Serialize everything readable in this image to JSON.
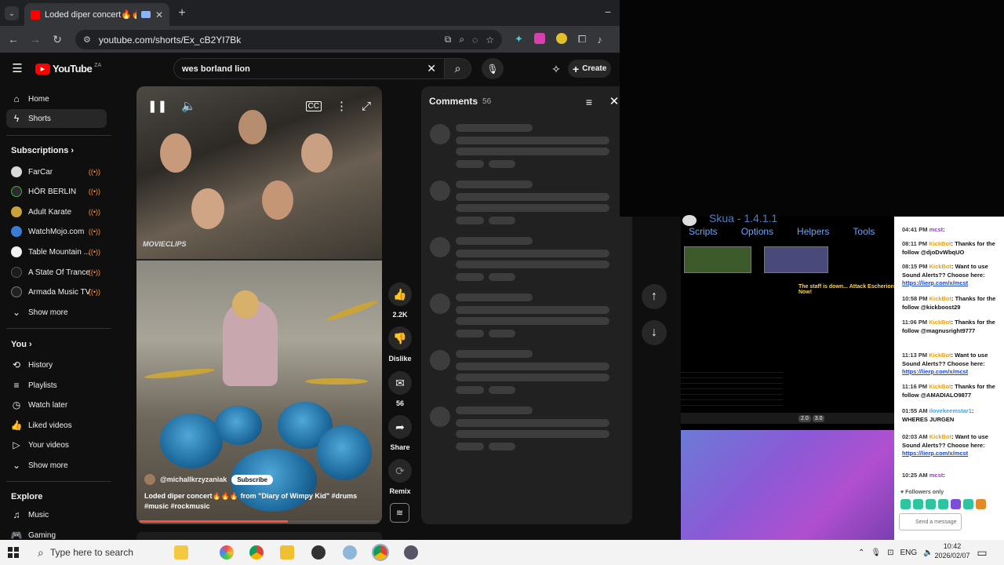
{
  "browser": {
    "tab_title": "Loded diper concert🔥🔥🔥",
    "url": "youtube.com/shorts/Ex_cB2YI7Bk",
    "new_tab": "+",
    "minimize": "−"
  },
  "youtube": {
    "logo": "YouTube",
    "logo_region": "ZA",
    "search_value": "wes borland lion",
    "create_label": "Create"
  },
  "sidebar": {
    "main": [
      {
        "label": "Home",
        "icon": "home-icon"
      },
      {
        "label": "Shorts",
        "icon": "shorts-icon"
      }
    ],
    "subscriptions_header": "Subscriptions",
    "subscriptions": [
      {
        "label": "FarCar",
        "color": "#d9d9d9"
      },
      {
        "label": "HÖR BERLIN",
        "color": "#2b2b2b"
      },
      {
        "label": "Adult Karate",
        "color": "#c9a13b"
      },
      {
        "label": "WatchMojo.com",
        "color": "#3a7bd5"
      },
      {
        "label": "Table Mountain ...",
        "color": "#f2f2f2"
      },
      {
        "label": "A State Of Trance",
        "color": "#1c1c1c"
      },
      {
        "label": "Armada Music TV",
        "color": "#222222"
      }
    ],
    "show_more_1": "Show more",
    "you_header": "You",
    "you_items": [
      {
        "label": "History",
        "icon": "history-icon"
      },
      {
        "label": "Playlists",
        "icon": "playlists-icon"
      },
      {
        "label": "Watch later",
        "icon": "watch-later-icon"
      },
      {
        "label": "Liked videos",
        "icon": "liked-icon"
      },
      {
        "label": "Your videos",
        "icon": "your-videos-icon"
      }
    ],
    "show_more_2": "Show more",
    "explore_header": "Explore",
    "explore_items": [
      {
        "label": "Music",
        "icon": "music-icon"
      },
      {
        "label": "Gaming",
        "icon": "gaming-icon"
      }
    ]
  },
  "short": {
    "channel": "@michallkrzyzaniak",
    "subscribe": "Subscribe",
    "title": "Loded diper concert🔥🔥🔥 from \"Diary of Wimpy Kid\" #drums #music #rockmusic",
    "watermark": "MOVIECLIPS",
    "progress": 0.62
  },
  "actions": {
    "likes": "2.2K",
    "dislike": "Dislike",
    "comments": "56",
    "share": "Share",
    "remix": "Remix"
  },
  "comments_panel": {
    "title": "Comments",
    "count": "56"
  },
  "stream": {
    "game_title": "Skua - 1.4.1.1",
    "menu": [
      "Scripts",
      "Options",
      "Helpers",
      "Tools"
    ],
    "status": "The staff is down... Attack Escherion Now!",
    "zoom": [
      "2.0",
      "3.0"
    ]
  },
  "chat": {
    "messages": [
      {
        "time": "04:41 PM",
        "user": "mcst",
        "text": ""
      },
      {
        "time": "08:11 PM",
        "user": "KickBot",
        "text": "Thanks for the follow @djoDvWbqUO"
      },
      {
        "time": "08:15 PM",
        "user": "KickBot",
        "text": "Want to use Sound Alerts?? Choose here:",
        "link": "https://lierp.com/x/mcst"
      },
      {
        "time": "10:58 PM",
        "user": "KickBot",
        "text": "Thanks for the follow @kickboost29"
      },
      {
        "time": "11:06 PM",
        "user": "KickBot",
        "text": "Thanks for the follow @magnusright9777"
      },
      {
        "time": "11:13 PM",
        "user": "KickBot",
        "text": "Want to use Sound Alerts?? Choose here:",
        "link": "https://lierp.com/x/mcst"
      },
      {
        "time": "11:16 PM",
        "user": "KickBot",
        "text": "Thanks for the follow @AMADIALO9877"
      },
      {
        "time": "01:55 AM",
        "user": "ilovekeemstar1",
        "text": "WHERES JURGEN"
      },
      {
        "time": "02:03 AM",
        "user": "KickBot",
        "text": "Want to use Sound Alerts?? Choose here:",
        "link": "https://lierp.com/x/mcst"
      },
      {
        "time": "10:25 AM",
        "user": "mcst",
        "text": ""
      }
    ],
    "followers_only": "Followers only",
    "send_placeholder": "Send a message"
  },
  "taskbar": {
    "search_placeholder": "Type here to search",
    "lang": "ENG",
    "time": "10:42",
    "date": "2026/02/07"
  }
}
